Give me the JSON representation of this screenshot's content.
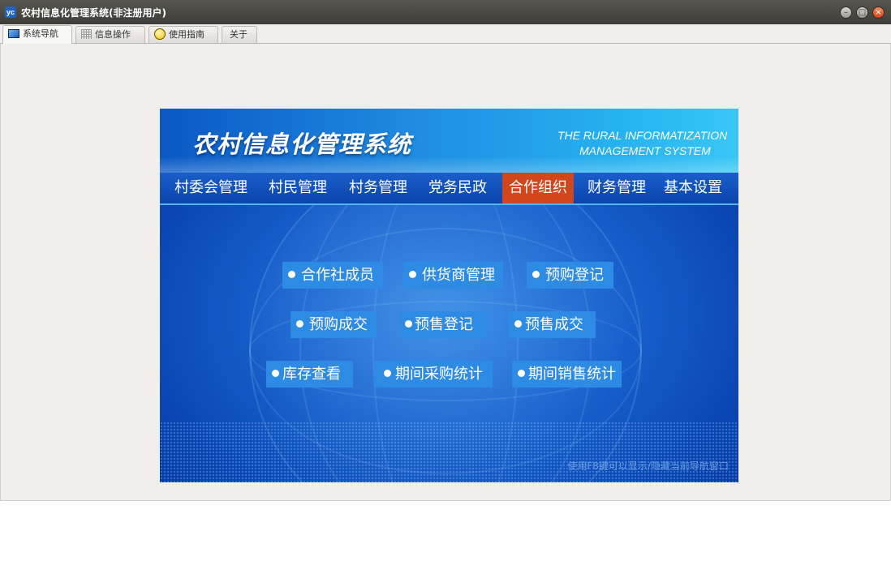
{
  "window": {
    "title": "农村信息化管理系统(非注册用户)",
    "icon": "app-logo-icon"
  },
  "tabs": [
    {
      "label": "系统导航",
      "icon": "monitor-icon",
      "active": true
    },
    {
      "label": "信息操作",
      "icon": "grid-icon"
    },
    {
      "label": "使用指南",
      "icon": "help-icon"
    },
    {
      "label": "关于"
    }
  ],
  "panel": {
    "title": "农村信息化管理系统",
    "title_en_line1": "THE RURAL INFORMATIZATION",
    "title_en_line2": "MANAGEMENT SYSTEM",
    "menu": [
      "村委会管理",
      "村民管理",
      "村务管理",
      "党务民政",
      "合作组织",
      "财务管理",
      "基本设置"
    ],
    "active_menu": "合作组织",
    "active_color": "#d1461b",
    "buttons": [
      "合作社成员",
      "供货商管理",
      "预购登记",
      "预购成交",
      "预售登记",
      "预售成交",
      "库存查看",
      "期间采购统计",
      "期间销售统计"
    ],
    "hint": "使用F8键可以显示/隐藏当前导航窗口"
  }
}
